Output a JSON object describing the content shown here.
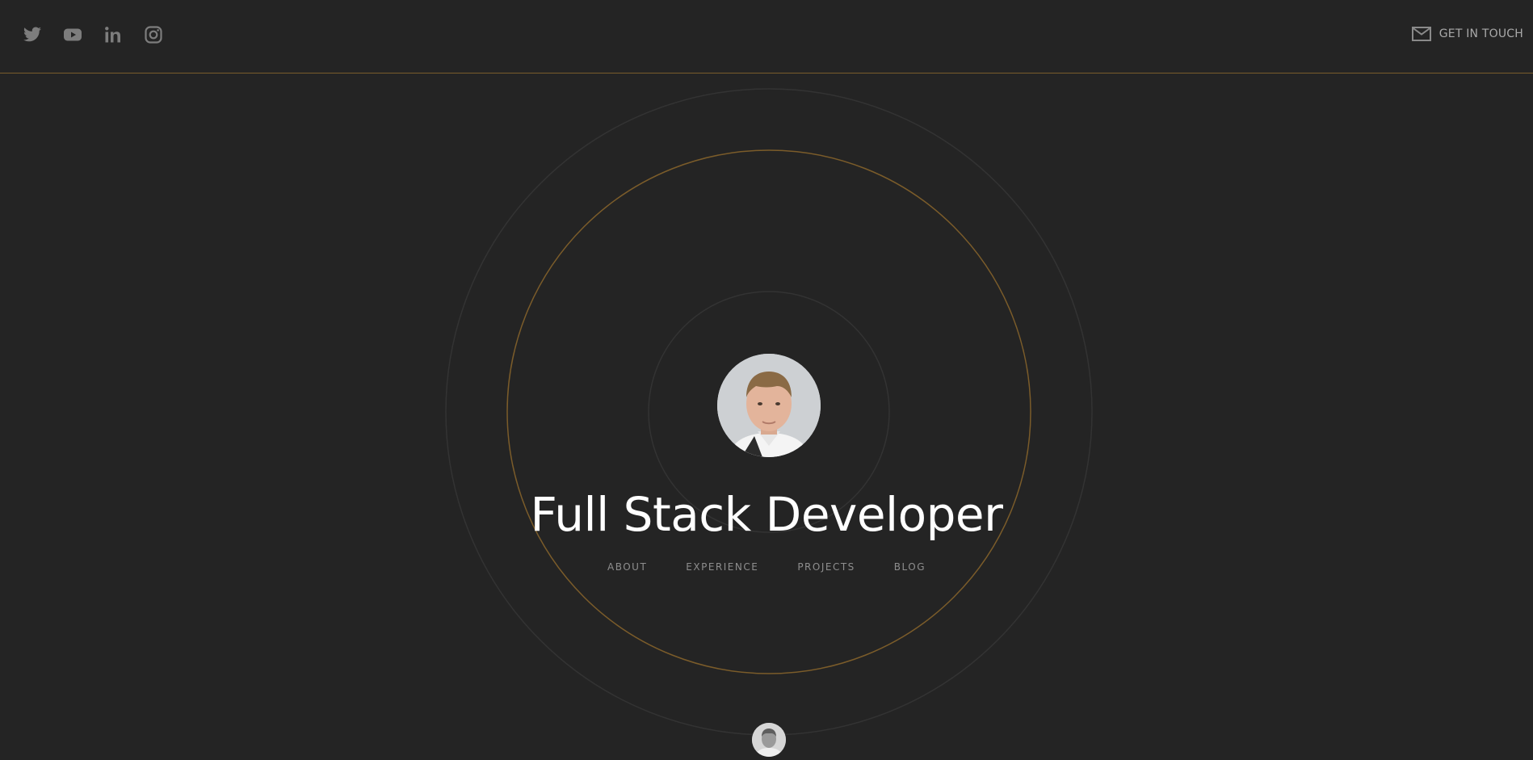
{
  "header": {
    "social": [
      {
        "name": "twitter-icon",
        "label": "Twitter"
      },
      {
        "name": "youtube-icon",
        "label": "YouTube"
      },
      {
        "name": "linkedin-icon",
        "label": "LinkedIn"
      },
      {
        "name": "instagram-icon",
        "label": "Instagram"
      }
    ],
    "contact_label": "GET IN TOUCH",
    "contact_icon": "mail-icon"
  },
  "hero": {
    "title": "Full Stack Developer",
    "avatar_icon": "profile-photo"
  },
  "nav": {
    "about": "ABOUT",
    "experience": "EXPERIENCE",
    "projects": "PROJECTS",
    "blog": "BLOG"
  },
  "colors": {
    "background": "#242424",
    "accent": "#8a6a33",
    "icon": "#7d7d7d",
    "title": "#ffffff",
    "nav_text": "#8e8e8e"
  }
}
